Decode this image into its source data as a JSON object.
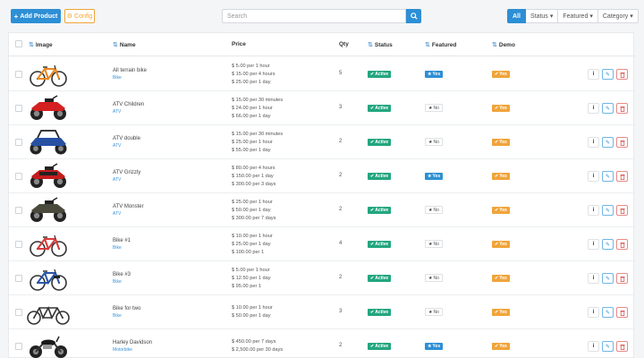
{
  "toolbar": {
    "add_product": "Add Product",
    "config": "Config",
    "search_placeholder": "Search",
    "filters": {
      "all": "All",
      "status": "Status",
      "featured": "Featured",
      "category": "Category"
    }
  },
  "columns": {
    "image": "Image",
    "name": "Name",
    "price": "Price",
    "qty": "Qty",
    "status": "Status",
    "featured": "Featured",
    "demo": "Demo"
  },
  "rows": [
    {
      "name": "All terrain bike",
      "category": "Bike",
      "prices": [
        "$ 5.00 per 1 hour",
        "$ 15.00 per 4 hours",
        "$ 25.00 per 1 day"
      ],
      "qty": "5",
      "status": "Active",
      "featured": "Yes",
      "demo": "Yes",
      "image": "bike-orange-icon"
    },
    {
      "name": "ATV Children",
      "category": "ATV",
      "prices": [
        "$ 15.00 per 30 minutes",
        "$ 24.00 per 1 hour",
        "$ 66.00 per 1 day"
      ],
      "qty": "3",
      "status": "Active",
      "featured": "No",
      "demo": "Yes",
      "image": "atv-red-icon"
    },
    {
      "name": "ATV double",
      "category": "ATV",
      "prices": [
        "$ 15.00 per 30 minutes",
        "$ 25.00 per 1 hour",
        "$ 55.00 per 1 day"
      ],
      "qty": "2",
      "status": "Active",
      "featured": "No",
      "demo": "Yes",
      "image": "utv-blue-icon"
    },
    {
      "name": "ATV Grizzly",
      "category": "ATV",
      "prices": [
        "$ 80.00 per 4 hours",
        "$ 150.00 per 1 day",
        "$ 300.00 per 3 days"
      ],
      "qty": "2",
      "status": "Active",
      "featured": "Yes",
      "demo": "Yes",
      "image": "atv-red-black-icon"
    },
    {
      "name": "ATV Monster",
      "category": "ATV",
      "prices": [
        "$ 25.00 per 1 hour",
        "$ 50.00 per 1 day",
        "$ 300.00 per 7 days"
      ],
      "qty": "2",
      "status": "Active",
      "featured": "No",
      "demo": "Yes",
      "image": "atv-dark-icon"
    },
    {
      "name": "Bike #1",
      "category": "Bike",
      "prices": [
        "$ 10.00 per 1 hour",
        "$ 25.00 per 1 day",
        "$ 100.00 per 1"
      ],
      "qty": "4",
      "status": "Active",
      "featured": "No",
      "demo": "Yes",
      "image": "bike-red-icon"
    },
    {
      "name": "Bike #3",
      "category": "Bike",
      "prices": [
        "$ 5.00 per 1 hour",
        "$ 12.50 per 1 day",
        "$ 95.00 per 1"
      ],
      "qty": "2",
      "status": "Active",
      "featured": "No",
      "demo": "Yes",
      "image": "bike-blue-icon"
    },
    {
      "name": "Bike for two",
      "category": "Bike",
      "prices": [
        "$ 10.00 per 1 hour",
        "$ 50.00 per 1 day"
      ],
      "qty": "3",
      "status": "Active",
      "featured": "No",
      "demo": "Yes",
      "image": "tandem-bike-icon"
    },
    {
      "name": "Harley Davidson",
      "category": "Motorbike",
      "prices": [
        "$ 450.00 per 7 days",
        "$ 2,500.00 per 30 days"
      ],
      "qty": "2",
      "status": "Active",
      "featured": "Yes",
      "demo": "Yes",
      "image": "motorbike-icon"
    }
  ],
  "colors": {
    "primary": "#2d8fd5",
    "active": "#23a67f",
    "demo": "#f0a43a",
    "danger": "#d9534f"
  }
}
